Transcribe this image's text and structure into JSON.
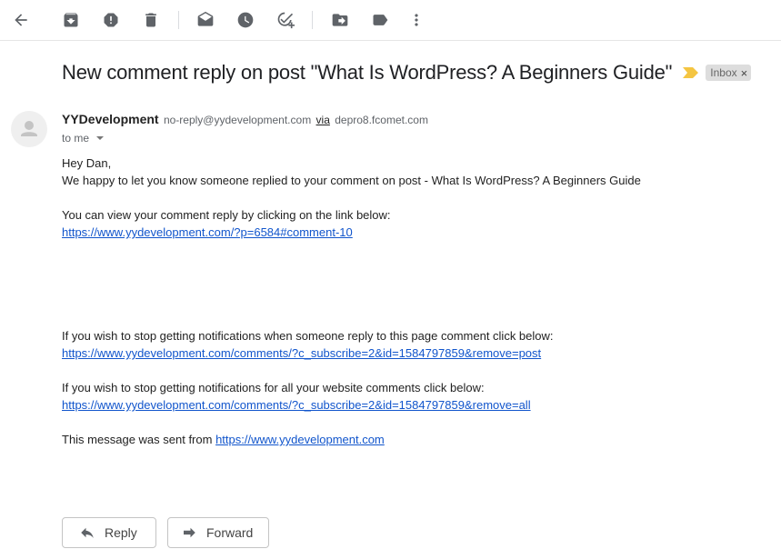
{
  "email": {
    "subject": "New comment reply on post \"What Is WordPress? A Beginners Guide\"",
    "label": "Inbox",
    "label_remove": "×",
    "sender_name": "YYDevelopment",
    "sender_email": "no-reply@yydevelopment.com",
    "via_label": "via",
    "via_host": "depro8.fcomet.com",
    "to_text": "to me",
    "body": {
      "greeting": "Hey Dan,",
      "intro": "We happy to let you know someone replied to your comment on post - What Is WordPress? A Beginners Guide",
      "view_text": "You can view your comment reply by clicking on the link below:",
      "view_link": "https://www.yydevelopment.com/?p=6584#comment-10",
      "stop_page_text": "If you wish to stop getting notifications when someone reply to this page comment click below:",
      "stop_page_link": "https://www.yydevelopment.com/comments/?c_subscribe=2&id=1584797859&remove=post",
      "stop_all_text": "If you wish to stop getting notifications for all your website comments click below:",
      "stop_all_link": "https://www.yydevelopment.com/comments/?c_subscribe=2&id=1584797859&remove=all",
      "sent_from_text": "This message was sent from",
      "sent_from_link": "https://www.yydevelopment.com"
    }
  },
  "actions": {
    "reply_label": "Reply",
    "forward_label": "Forward"
  },
  "icons": {
    "toolbar": [
      "back-arrow-icon",
      "archive-icon",
      "report-spam-icon",
      "delete-icon",
      "mark-unread-icon",
      "snooze-icon",
      "add-to-tasks-icon",
      "move-to-icon",
      "label-icon",
      "more-vert-icon"
    ],
    "importance": "importance-marker-icon",
    "avatar": "person-icon"
  },
  "colors": {
    "importance": "#f4c542",
    "link": "#1155cc",
    "label_chip": "#dddddd"
  }
}
